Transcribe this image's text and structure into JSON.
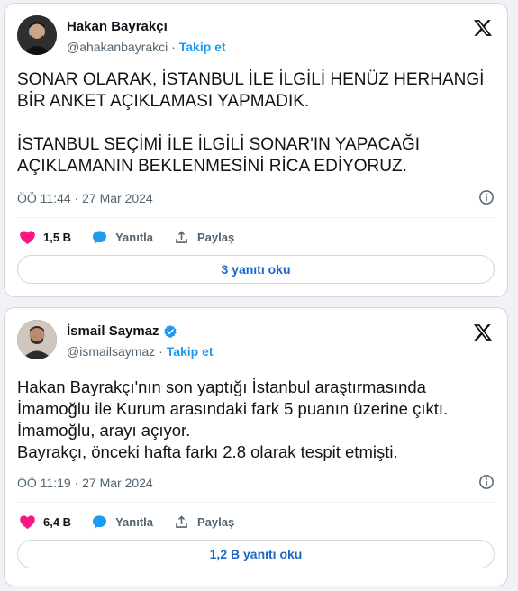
{
  "tweets": [
    {
      "author": {
        "name": "Hakan Bayrakçı",
        "handle": "@ahakanbayrakci",
        "separator": " · ",
        "follow_label": "Takip et",
        "verified": false
      },
      "text": "SONAR OLARAK, İSTANBUL İLE İLGİLİ HENÜZ HERHANGİ\nBİR ANKET AÇIKLAMASI YAPMADIK.\n\nİSTANBUL SEÇİMİ İLE İLGİLİ SONAR'IN YAPACAĞI\nAÇIKLAMANIN BEKLENMESİNİ RİCA EDİYORUZ.",
      "timestamp": "ÖÖ 11:44 · 27 Mar 2024",
      "likes": "1,5 B",
      "reply_label": "Yanıtla",
      "share_label": "Paylaş",
      "read_replies_label": "3 yanıtı oku"
    },
    {
      "author": {
        "name": "İsmail Saymaz",
        "handle": "@ismailsaymaz",
        "separator": " · ",
        "follow_label": "Takip et",
        "verified": true
      },
      "text": "Hakan Bayrakçı'nın son yaptığı İstanbul araştırmasında\nİmamoğlu ile Kurum arasındaki fark 5 puanın üzerine çıktı.\nİmamoğlu, arayı açıyor.\nBayrakçı, önceki hafta farkı 2.8 olarak tespit etmişti.",
      "timestamp": "ÖÖ 11:19 · 27 Mar 2024",
      "likes": "6,4 B",
      "reply_label": "Yanıtla",
      "share_label": "Paylaş",
      "read_replies_label": "1,2 B yanıtı oku"
    }
  ],
  "colors": {
    "accent": "#1d9bf0",
    "like": "#f91880",
    "muted": "#536471"
  },
  "icons": [
    "x-logo-icon",
    "heart-icon",
    "reply-bubble-icon",
    "share-icon",
    "info-icon",
    "verified-badge-icon"
  ]
}
